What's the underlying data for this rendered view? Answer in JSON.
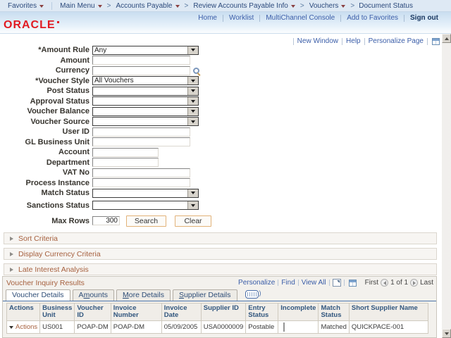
{
  "topbar": {
    "separator": ">",
    "favorites": "Favorites",
    "main_menu": "Main Menu",
    "crumbs": [
      "Accounts Payable",
      "Review Accounts Payable Info",
      "Vouchers"
    ],
    "current": "Document Status"
  },
  "header": {
    "logo": "ORACLE",
    "links": [
      "Home",
      "Worklist",
      "MultiChannel Console",
      "Add to Favorites"
    ],
    "sign_out": "Sign out"
  },
  "pagebar": {
    "links": [
      "New Window",
      "Help",
      "Personalize Page"
    ],
    "grid_icon": "personalize-layout-icon"
  },
  "form": {
    "fields": [
      {
        "label": "*Amount Rule",
        "type": "select",
        "value": "Any"
      },
      {
        "label": "Amount",
        "type": "text",
        "value": ""
      },
      {
        "label": "Currency",
        "type": "text-lookup",
        "value": ""
      },
      {
        "label": "*Voucher Style",
        "type": "select",
        "value": "All Vouchers"
      },
      {
        "label": "Post Status",
        "type": "select",
        "value": ""
      },
      {
        "label": "Approval Status",
        "type": "select",
        "value": ""
      },
      {
        "label": "Voucher Balance",
        "type": "select",
        "value": ""
      },
      {
        "label": "Voucher Source",
        "type": "select",
        "value": ""
      },
      {
        "label": "User ID",
        "type": "text",
        "value": ""
      },
      {
        "label": "GL Business Unit",
        "type": "text",
        "value": ""
      },
      {
        "label": "Account",
        "type": "text-short",
        "value": ""
      },
      {
        "label": "Department",
        "type": "text-short",
        "value": ""
      },
      {
        "label": "VAT No",
        "type": "text",
        "value": ""
      },
      {
        "label": "Process Instance",
        "type": "text",
        "value": ""
      },
      {
        "label": "Match Status",
        "type": "select",
        "value": ""
      },
      {
        "label": "Sanctions Status",
        "type": "select",
        "value": ""
      }
    ],
    "max_rows": {
      "label": "Max Rows",
      "value": "300"
    },
    "buttons": {
      "search": "Search",
      "clear": "Clear"
    }
  },
  "sections": [
    {
      "label": "Sort Criteria"
    },
    {
      "label": "Display Currency Criteria"
    },
    {
      "label": "Late Interest Analysis"
    }
  ],
  "results": {
    "title": "Voucher Inquiry Results",
    "toolbar": {
      "personalize": "Personalize",
      "find": "Find",
      "view_all": "View All"
    },
    "pager": {
      "first": "First",
      "count": "1 of 1",
      "last": "Last"
    },
    "tabs": [
      {
        "label": "Voucher Details",
        "active": true
      },
      {
        "pre": "A",
        "key": "m",
        "suf": "ounts"
      },
      {
        "pre": "",
        "key": "M",
        "suf": "ore Details"
      },
      {
        "pre": "",
        "key": "S",
        "suf": "upplier Details"
      }
    ],
    "columns": [
      "Actions",
      "Business Unit",
      "Voucher ID",
      "Invoice Number",
      "Invoice Date",
      "Supplier ID",
      "Entry Status",
      "Incomplete",
      "Match Status",
      "Short Supplier Name"
    ],
    "rows": [
      {
        "actions": "Actions",
        "business_unit": "US001",
        "voucher_id": "POAP-DM",
        "invoice_number": "POAP-DM",
        "invoice_date": "05/09/2005",
        "supplier_id": "USA0000009",
        "entry_status": "Postable",
        "incomplete": false,
        "match_status": "Matched",
        "short_supplier_name": "QUICKPACE-001"
      }
    ]
  },
  "colors": {
    "link_blue": "#3a5da8",
    "accent_orange": "#a6603e",
    "oracle_red": "#e11b22",
    "tab_underline": "#4a72a8",
    "grid_header_text": "#31567e"
  }
}
